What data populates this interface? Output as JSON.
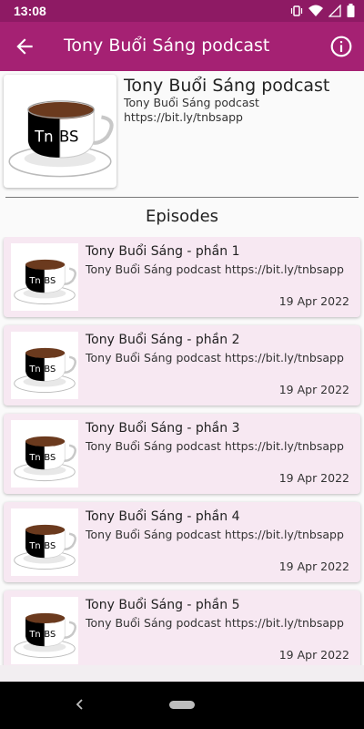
{
  "status_bar": {
    "time": "13:08",
    "icons": [
      "vibrate-icon",
      "wifi-icon",
      "signal-icon",
      "battery-icon"
    ]
  },
  "app_bar": {
    "title": "Tony Buổi Sáng podcast",
    "back_icon": "arrow-back-icon",
    "info_icon": "info-icon",
    "color": "#a52173"
  },
  "podcast": {
    "title": "Tony Buổi Sáng podcast",
    "author": "Tony Buổi Sáng podcast",
    "link": "https://bit.ly/tnbsapp",
    "logo_text": "TnBS"
  },
  "section": {
    "title": "Episodes"
  },
  "episodes": [
    {
      "title": "Tony Buổi Sáng - phần 1",
      "description": "Tony Buổi Sáng podcast https://bit.ly/tnbsapp",
      "date": "19 Apr 2022"
    },
    {
      "title": "Tony Buổi Sáng - phần 2",
      "description": "Tony Buổi Sáng podcast https://bit.ly/tnbsapp",
      "date": "19 Apr 2022"
    },
    {
      "title": "Tony Buổi Sáng - phần 3",
      "description": "Tony Buổi Sáng podcast https://bit.ly/tnbsapp",
      "date": "19 Apr 2022"
    },
    {
      "title": "Tony Buổi Sáng - phần 4",
      "description": "Tony Buổi Sáng podcast https://bit.ly/tnbsapp",
      "date": "19 Apr 2022"
    },
    {
      "title": "Tony Buổi Sáng - phần 5",
      "description": "Tony Buổi Sáng podcast https://bit.ly/tnbsapp",
      "date": "19 Apr 2022"
    }
  ],
  "colors": {
    "card_background": "#f7e8f2",
    "status_bar": "#8e1a64"
  }
}
